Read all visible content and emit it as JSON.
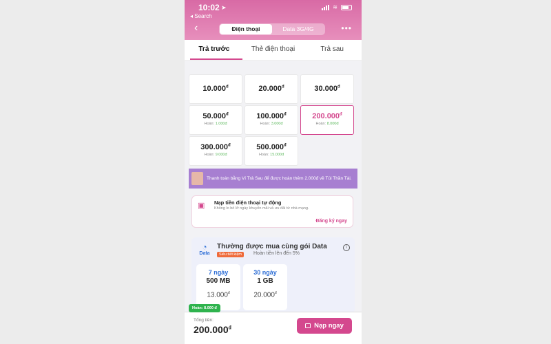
{
  "status": {
    "time": "10:02",
    "back_app": "◂ Search"
  },
  "header": {
    "back_icon": "chevron-left-icon",
    "segments": [
      {
        "label": "Điện thoại",
        "active": true
      },
      {
        "label": "Data 3G/4G",
        "active": false
      }
    ],
    "more_icon": "more-icon"
  },
  "tabs": [
    {
      "label": "Trả trước",
      "active": true
    },
    {
      "label": "Thẻ điện thoại",
      "active": false
    },
    {
      "label": "Trả sau",
      "active": false
    }
  ],
  "denominations": [
    {
      "amount": "10.000",
      "unit": "đ",
      "cashback": ""
    },
    {
      "amount": "20.000",
      "unit": "đ",
      "cashback": ""
    },
    {
      "amount": "30.000",
      "unit": "đ",
      "cashback": ""
    },
    {
      "amount": "50.000",
      "unit": "đ",
      "cashback_label": "Hoàn:",
      "cashback": "1.000đ"
    },
    {
      "amount": "100.000",
      "unit": "đ",
      "cashback_label": "Hoàn:",
      "cashback": "3.000đ"
    },
    {
      "amount": "200.000",
      "unit": "đ",
      "cashback_label": "Hoàn:",
      "cashback": "8.000đ",
      "selected": true
    },
    {
      "amount": "300.000",
      "unit": "đ",
      "cashback_label": "Hoàn:",
      "cashback": "9.000đ"
    },
    {
      "amount": "500.000",
      "unit": "đ",
      "cashback_label": "Hoàn:",
      "cashback": "15.000đ"
    }
  ],
  "promo_banner": {
    "text": "Thanh toán bằng Ví Trả Sau để được hoàn thêm 2.000đ về Túi Thần Tài."
  },
  "auto_topup": {
    "title": "Nạp tiền điện thoại tự động",
    "desc": "Không lo bỏ lỡ ngày khuyến mãi và ưu đãi từ nhà mạng.",
    "cta": "Đăng ký ngay",
    "icon": "calendar-icon"
  },
  "data_section": {
    "logo_label": "Data",
    "title": "Thường được mua cùng gói Data",
    "badge": "Siêu tiết kiệm",
    "cashback_text": "Hoàn tiền lên đến 5%",
    "info_icon": "info-icon",
    "packages": [
      {
        "duration": "7 ngày",
        "size": "500 MB",
        "price": "13.000",
        "unit": "đ"
      },
      {
        "duration": "30 ngày",
        "size": "1 GB",
        "price": "20.000",
        "unit": "đ"
      }
    ]
  },
  "footer": {
    "cashback_tag": "Hoàn: 8.000 đ",
    "total_label": "Tổng tiền:",
    "total": "200.000",
    "unit": "đ",
    "pay_label": "Nạp ngay"
  },
  "colors": {
    "accent": "#d4488e",
    "header": "#e07fb1",
    "promo": "#a77fd1"
  }
}
